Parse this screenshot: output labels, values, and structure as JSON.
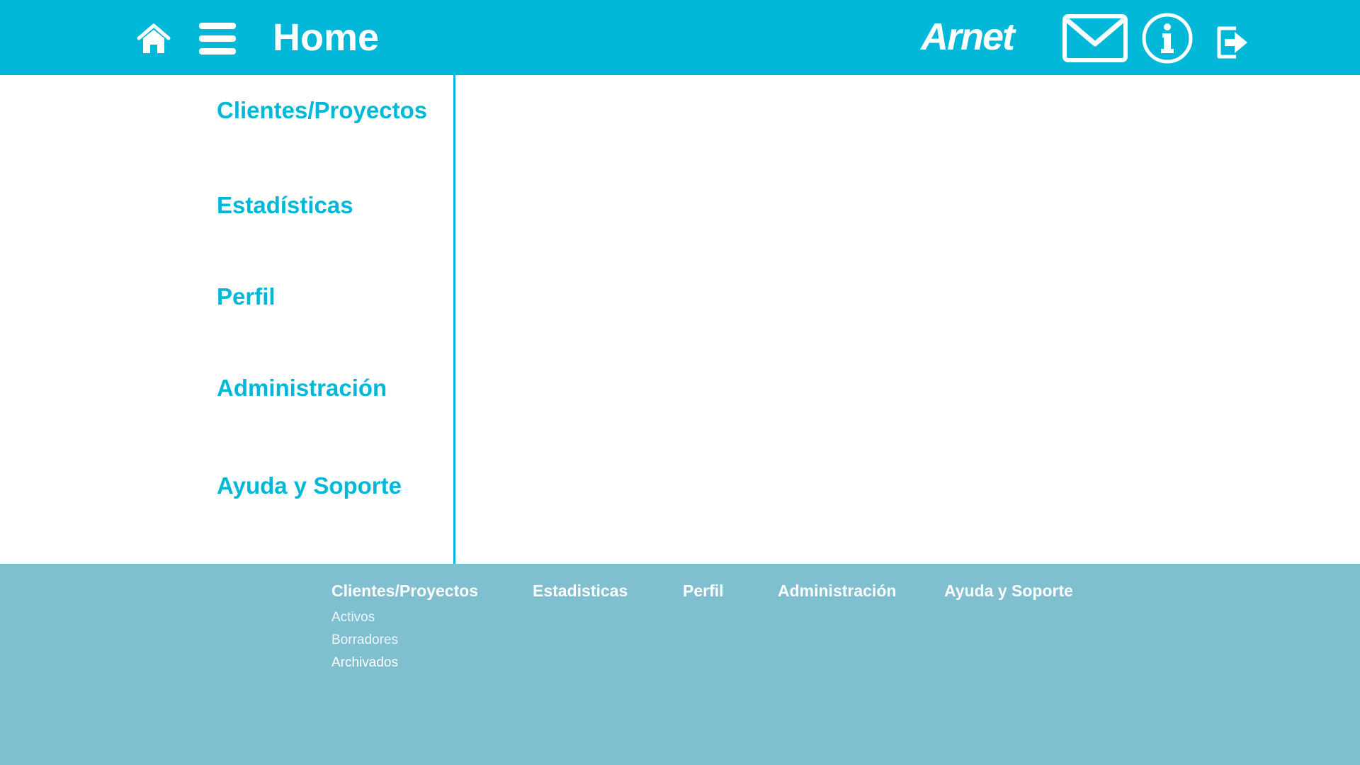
{
  "header": {
    "title": "Home",
    "logo_text": "Arnet",
    "icons": {
      "home": "home-icon",
      "menu": "hamburger-menu-icon",
      "mail": "mail-icon",
      "info": "info-icon",
      "logout": "logout-icon"
    }
  },
  "sidebar": {
    "items": [
      {
        "label": "Clientes/Proyectos"
      },
      {
        "label": "Estadísticas"
      },
      {
        "label": "Perfil"
      },
      {
        "label": "Administración"
      },
      {
        "label": "Ayuda y Soporte"
      }
    ]
  },
  "footer": {
    "columns": [
      {
        "label": "Clientes/Proyectos"
      },
      {
        "label": "Estadisticas"
      },
      {
        "label": "Perfil"
      },
      {
        "label": "Administración"
      },
      {
        "label": "Ayuda y Soporte"
      }
    ],
    "sublinks": [
      {
        "label": "Activos"
      },
      {
        "label": "Borradores"
      },
      {
        "label": "Archivados"
      }
    ]
  },
  "colors": {
    "accent": "#02b8d9",
    "footer_bg": "#80bfd0",
    "background": "#ffffff"
  }
}
